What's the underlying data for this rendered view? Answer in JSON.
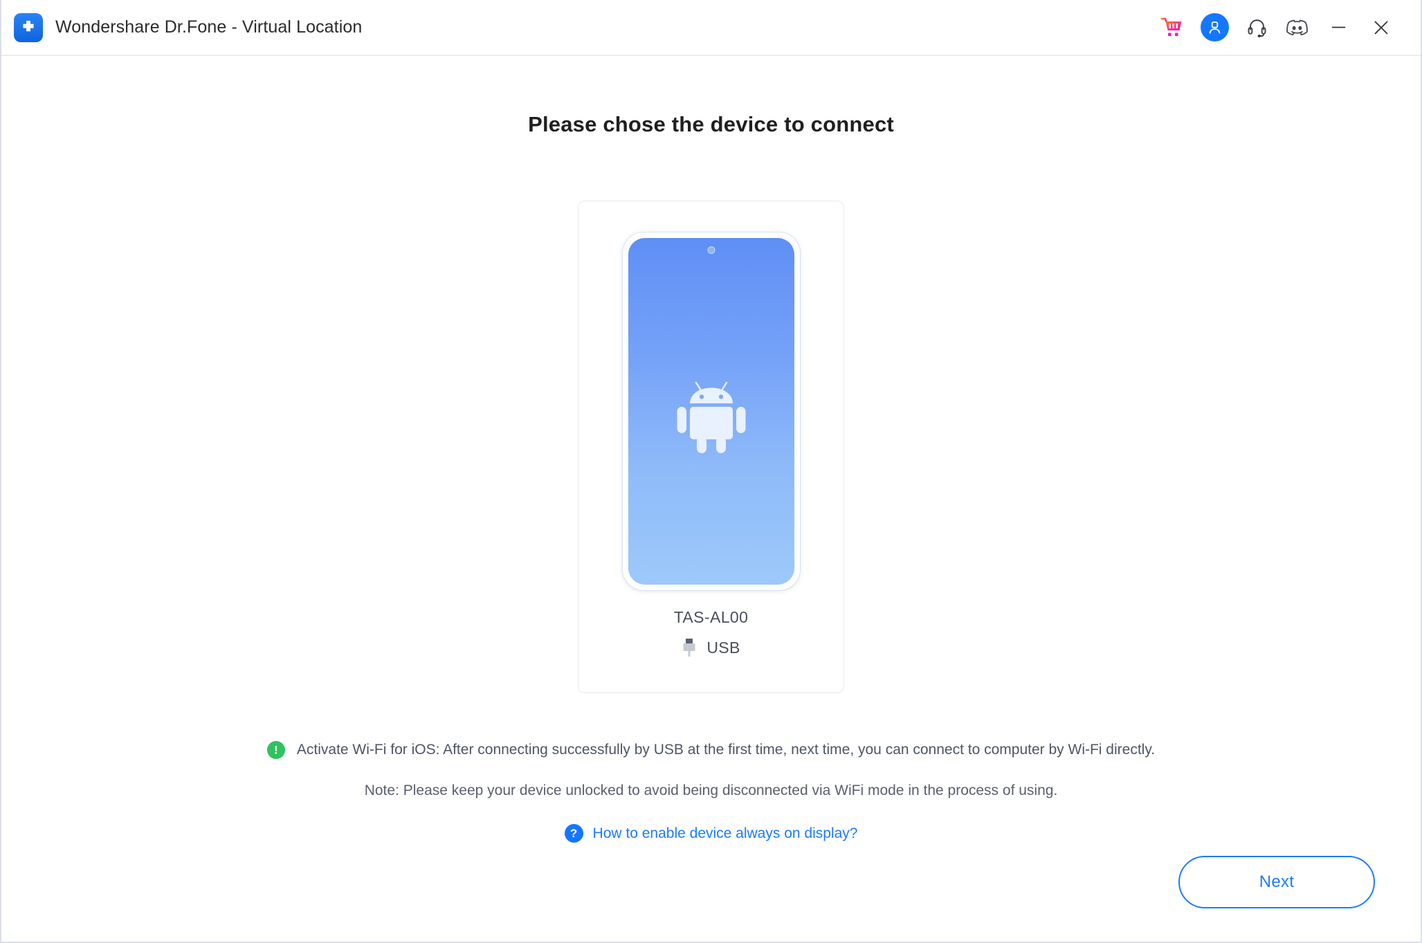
{
  "window": {
    "title": "Wondershare Dr.Fone - Virtual Location",
    "logo_icon": "dr-fone-cross-logo"
  },
  "titlebar": {
    "actions": [
      {
        "name": "shopping-cart-icon",
        "label": "Shop"
      },
      {
        "name": "user-account-icon",
        "label": "Account"
      },
      {
        "name": "headset-support-icon",
        "label": "Support"
      },
      {
        "name": "discord-icon",
        "label": "Discord"
      },
      {
        "name": "minimize-icon",
        "label": "Minimize"
      },
      {
        "name": "close-icon",
        "label": "Close"
      }
    ]
  },
  "main": {
    "page_title": "Please chose the device to connect",
    "device": {
      "name": "TAS-AL00",
      "connection_type": "USB",
      "connection_icon": "usb-plug-icon",
      "screen_icon": "android-robot-icon"
    },
    "notices": {
      "wifi_icon": "exclamation-icon",
      "wifi_text": "Activate Wi-Fi for iOS:  After connecting successfully by USB at the first time, next time, you can connect to computer by Wi-Fi directly.",
      "note_text": "Note: Please keep your device unlocked to avoid being disconnected via WiFi mode in the process of using.",
      "help_icon": "question-mark-icon",
      "help_link": "How to enable device always on display?"
    },
    "next_button": "Next"
  },
  "colors": {
    "accent_blue": "#1477ff",
    "link_blue": "#1b7bfa",
    "success_green": "#2ec35f",
    "cart_pink": "#ef1fb0",
    "phone_screen_top": "#5f8ff5",
    "phone_screen_bottom": "#9dc9fb"
  }
}
